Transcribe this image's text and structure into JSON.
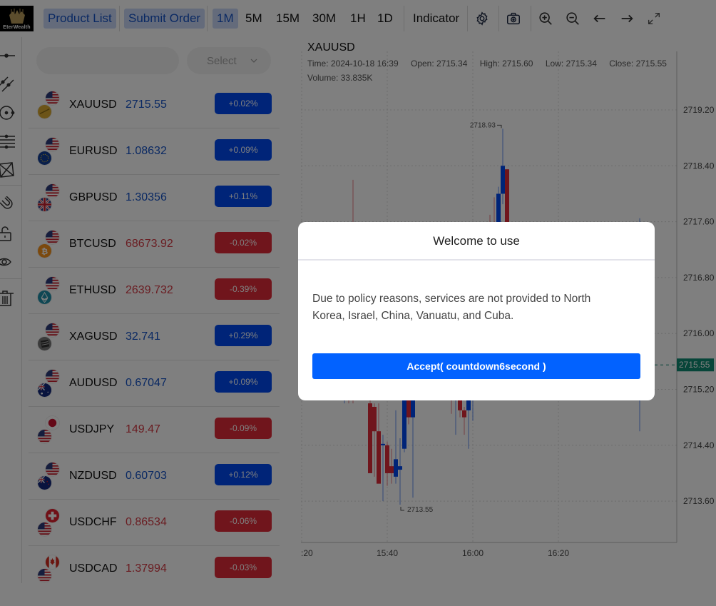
{
  "logo": {
    "text": "EterWealth"
  },
  "toolbar": {
    "product_list": "Product List",
    "submit_order": "Submit Order",
    "timeframes": [
      "1M",
      "5M",
      "15M",
      "30M",
      "1H",
      "1D"
    ],
    "active_timeframe": "1M",
    "indicator": "Indicator",
    "icons": [
      "settings-icon",
      "camera-icon",
      "zoom-in-icon",
      "zoom-out-icon",
      "arrow-left-icon",
      "arrow-right-icon",
      "fullscreen-icon"
    ]
  },
  "drawing_tools": [
    "horizontal-line-icon",
    "trend-line-icon",
    "circle-icon",
    "parallel-lines-icon",
    "pattern-icon",
    "magnet-icon",
    "unlock-icon",
    "eye-icon",
    "trash-icon"
  ],
  "product_list": {
    "search_placeholder": "",
    "select_placeholder": "Select",
    "items": [
      {
        "symbol": "XAUUSD",
        "price": "2715.55",
        "change": "+0.02%",
        "direction": "up",
        "base": "gold",
        "quote": "us"
      },
      {
        "symbol": "EURUSD",
        "price": "1.08632",
        "change": "+0.09%",
        "direction": "up",
        "base": "eu",
        "quote": "us"
      },
      {
        "symbol": "GBPUSD",
        "price": "1.30356",
        "change": "+0.11%",
        "direction": "up",
        "base": "gb",
        "quote": "us"
      },
      {
        "symbol": "BTCUSD",
        "price": "68673.92",
        "change": "-0.02%",
        "direction": "down",
        "base": "btc",
        "quote": "us"
      },
      {
        "symbol": "ETHUSD",
        "price": "2639.732",
        "change": "-0.39%",
        "direction": "down",
        "base": "eth",
        "quote": "us"
      },
      {
        "symbol": "XAGUSD",
        "price": "32.741",
        "change": "+0.29%",
        "direction": "up",
        "base": "silver",
        "quote": "us"
      },
      {
        "symbol": "AUDUSD",
        "price": "0.67047",
        "change": "+0.09%",
        "direction": "up",
        "base": "au",
        "quote": "us"
      },
      {
        "symbol": "USDJPY",
        "price": "149.47",
        "change": "-0.09%",
        "direction": "down",
        "base": "us",
        "quote": "jp"
      },
      {
        "symbol": "NZDUSD",
        "price": "0.60703",
        "change": "+0.12%",
        "direction": "up",
        "base": "nz",
        "quote": "us"
      },
      {
        "symbol": "USDCHF",
        "price": "0.86534",
        "change": "-0.06%",
        "direction": "down",
        "base": "us",
        "quote": "ch"
      },
      {
        "symbol": "USDCAD",
        "price": "1.37994",
        "change": "-0.03%",
        "direction": "down",
        "base": "us",
        "quote": "ca"
      }
    ]
  },
  "chart": {
    "symbol": "XAUUSD",
    "time": "Time: 2024-10-18 16:39",
    "open": "Open: 2715.34",
    "high": "High: 2715.60",
    "low": "Low: 2715.34",
    "close": "Close: 2715.55",
    "volume": "Volume: 33.835K",
    "colors": {
      "up": "#0149f0",
      "down": "#e02b38",
      "last_price": "#0f8a72"
    }
  },
  "chart_data": {
    "type": "candlestick",
    "title": "XAUUSD",
    "xlabel": "",
    "ylabel": "",
    "x_ticks": [
      ":20",
      "15:40",
      "16:00",
      "16:20"
    ],
    "y_ticks": [
      "2719.20",
      "2718.40",
      "2717.60",
      "2716.80",
      "2716.00",
      "2715.20",
      "2714.40",
      "2713.60"
    ],
    "ylim": [
      2713.2,
      2719.5
    ],
    "last_price": 2715.55,
    "last_price_label": "2715.55",
    "max_marker": {
      "value": 2718.93,
      "label": "2718.93"
    },
    "min_marker": {
      "value": 2713.55,
      "label": "2713.55"
    },
    "grid": true,
    "candles_visible": [
      {
        "t": "15:30",
        "o": 2717.0,
        "h": 2717.38,
        "l": 2715.0,
        "c": 2717.35,
        "dir": "up"
      },
      {
        "t": "15:31",
        "o": 2717.33,
        "h": 2717.5,
        "l": 2715.0,
        "c": 2716.9,
        "dir": "down"
      },
      {
        "t": "15:32",
        "o": 2716.9,
        "h": 2718.2,
        "l": 2715.0,
        "c": 2716.0,
        "dir": "down"
      },
      {
        "t": "15:36",
        "o": 2715.0,
        "h": 2715.4,
        "l": 2714.95,
        "c": 2714.0,
        "dir": "down"
      },
      {
        "t": "15:37",
        "o": 2714.95,
        "h": 2715.0,
        "l": 2713.95,
        "c": 2714.6,
        "dir": "down"
      },
      {
        "t": "15:38",
        "o": 2714.6,
        "h": 2715.0,
        "l": 2713.9,
        "c": 2713.85,
        "dir": "down"
      },
      {
        "t": "15:39",
        "o": 2714.4,
        "h": 2714.55,
        "l": 2713.6,
        "c": 2714.42,
        "dir": "up"
      },
      {
        "t": "15:40",
        "o": 2714.4,
        "h": 2714.45,
        "l": 2713.82,
        "c": 2714.0,
        "dir": "down"
      },
      {
        "t": "15:41",
        "o": 2714.0,
        "h": 2714.35,
        "l": 2713.85,
        "c": 2714.1,
        "dir": "down"
      },
      {
        "t": "15:42",
        "o": 2713.95,
        "h": 2714.9,
        "l": 2713.85,
        "c": 2714.2,
        "dir": "up"
      },
      {
        "t": "15:43",
        "o": 2714.05,
        "h": 2714.5,
        "l": 2713.55,
        "c": 2714.1,
        "dir": "up"
      },
      {
        "t": "15:44",
        "o": 2714.35,
        "h": 2715.2,
        "l": 2714.3,
        "c": 2715.2,
        "dir": "up"
      },
      {
        "t": "15:45",
        "o": 2715.3,
        "h": 2715.5,
        "l": 2714.7,
        "c": 2714.8,
        "dir": "down"
      },
      {
        "t": "15:46",
        "o": 2714.8,
        "h": 2715.2,
        "l": 2713.65,
        "c": 2715.2,
        "dir": "up"
      },
      {
        "t": "15:55",
        "o": 2715.2,
        "h": 2715.3,
        "l": 2714.85,
        "c": 2715.05,
        "dir": "down"
      },
      {
        "t": "15:56",
        "o": 2715.3,
        "h": 2715.35,
        "l": 2714.55,
        "c": 2715.2,
        "dir": "up"
      },
      {
        "t": "15:57",
        "o": 2715.2,
        "h": 2715.3,
        "l": 2714.8,
        "c": 2714.9,
        "dir": "down"
      },
      {
        "t": "15:58",
        "o": 2714.9,
        "h": 2714.95,
        "l": 2714.55,
        "c": 2714.8,
        "dir": "down"
      },
      {
        "t": "15:59",
        "o": 2715.2,
        "h": 2715.3,
        "l": 2714.35,
        "c": 2714.9,
        "dir": "up"
      },
      {
        "t": "16:00",
        "o": 2715.2,
        "h": 2715.3,
        "l": 2714.75,
        "c": 2715.2,
        "dir": "up"
      },
      {
        "t": "16:03",
        "o": 2715.3,
        "h": 2717.4,
        "l": 2715.2,
        "c": 2717.3,
        "dir": "up"
      },
      {
        "t": "16:04",
        "o": 2717.1,
        "h": 2717.7,
        "l": 2715.2,
        "c": 2717.12,
        "dir": "down"
      },
      {
        "t": "16:05",
        "o": 2717.15,
        "h": 2717.95,
        "l": 2715.6,
        "c": 2716.8,
        "dir": "down"
      },
      {
        "t": "16:06",
        "o": 2716.75,
        "h": 2718.1,
        "l": 2715.2,
        "c": 2718.0,
        "dir": "up"
      },
      {
        "t": "16:07",
        "o": 2718.0,
        "h": 2718.93,
        "l": 2717.85,
        "c": 2718.4,
        "dir": "up"
      },
      {
        "t": "16:08",
        "o": 2718.35,
        "h": 2718.35,
        "l": 2715.2,
        "c": 2715.3,
        "dir": "down"
      },
      {
        "t": "16:39",
        "o": 2715.34,
        "h": 2717.65,
        "l": 2714.6,
        "c": 2715.55,
        "dir": "up"
      }
    ]
  },
  "modal": {
    "title": "Welcome to use",
    "body": "Due to policy reasons, services are not provided to North Korea, Israel, China, Vanuatu, and Cuba.",
    "accept_label": "Accept( countdown6second )"
  }
}
